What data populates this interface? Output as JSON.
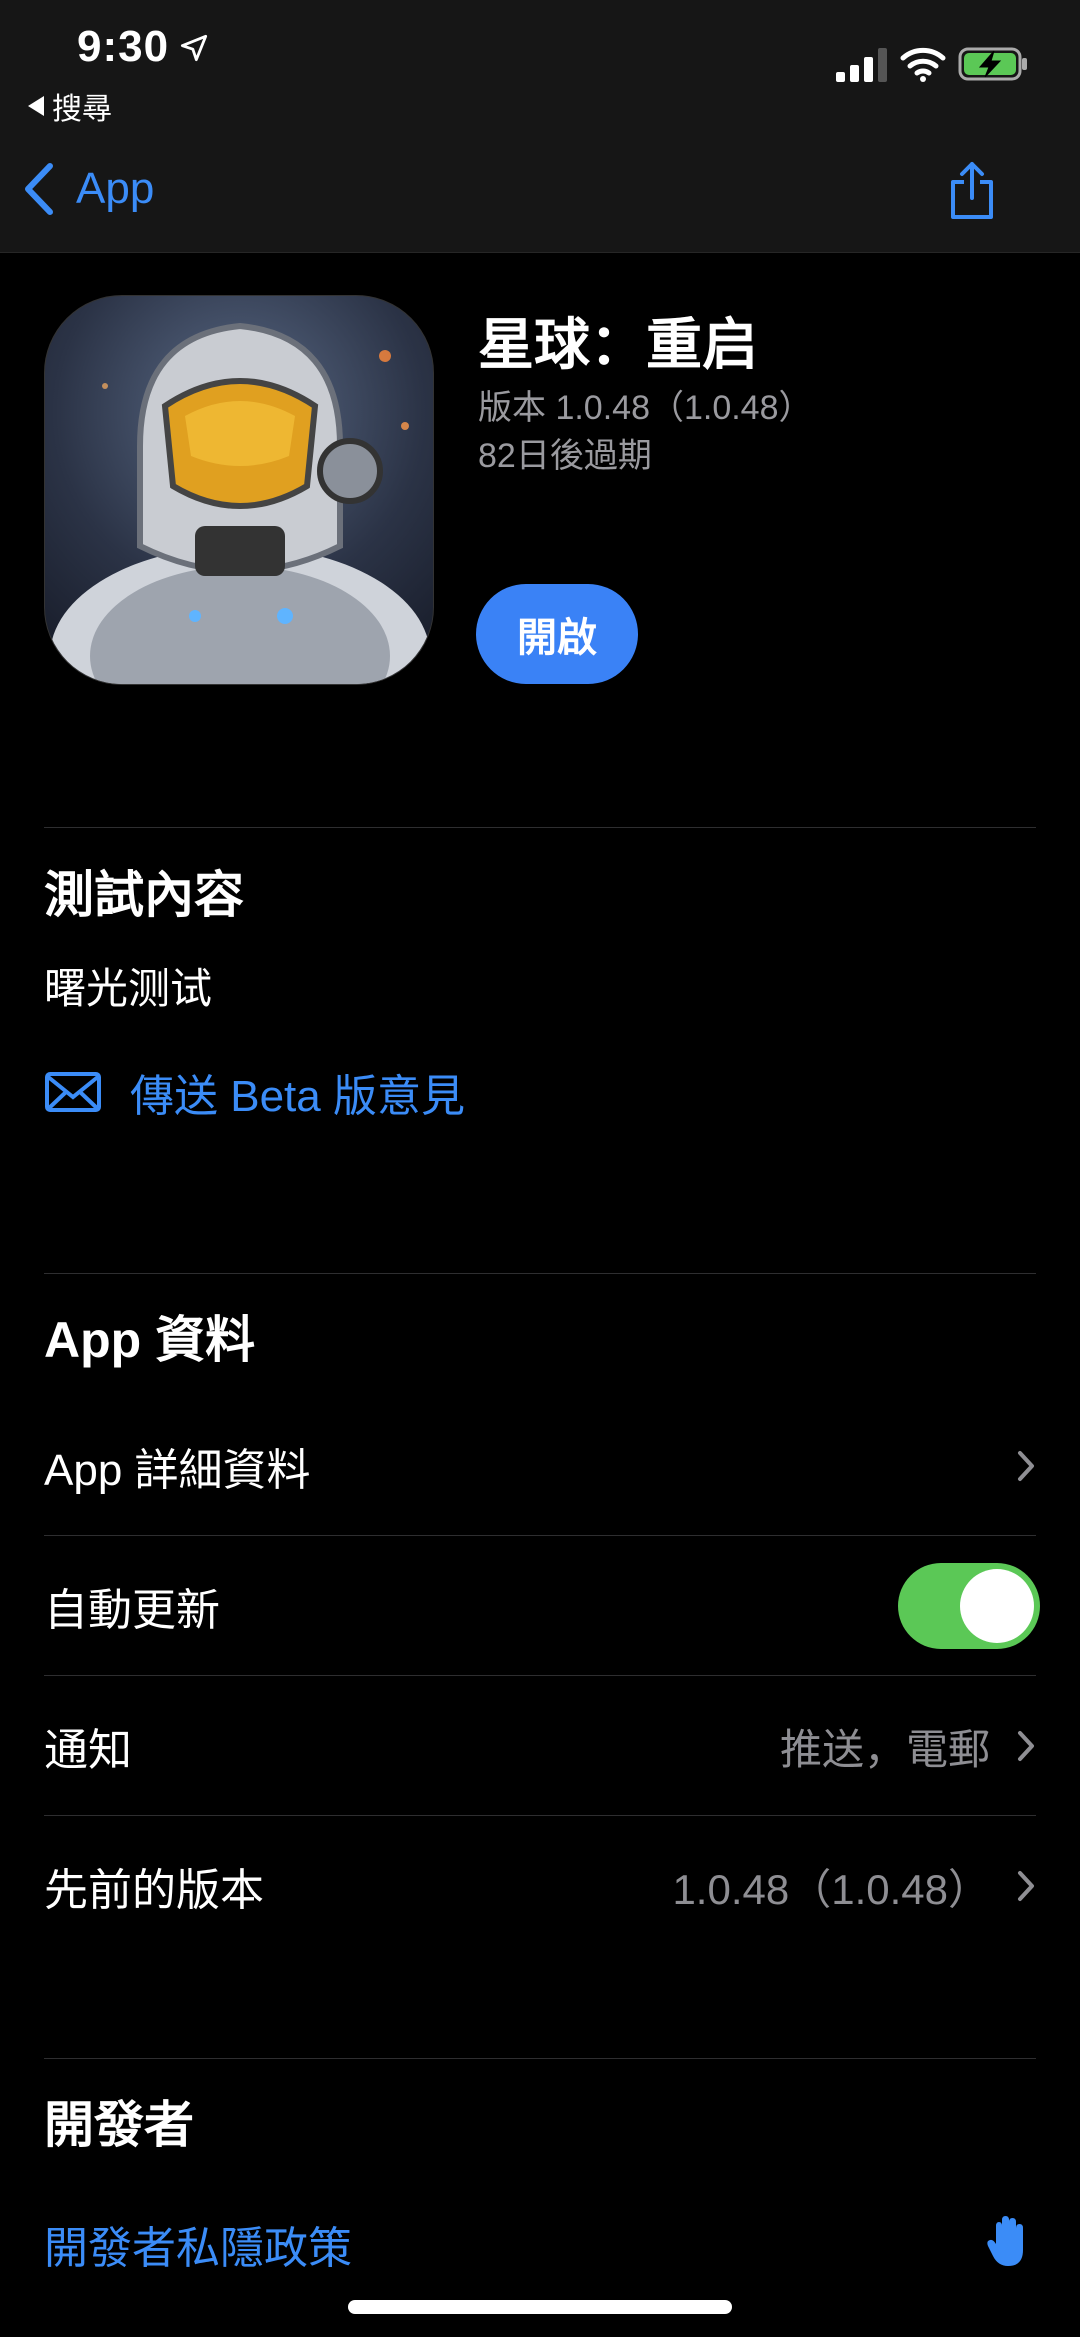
{
  "status_bar": {
    "time": "9:30",
    "back_label": "搜尋"
  },
  "nav": {
    "back_label": "App"
  },
  "app": {
    "title": "星球：重启",
    "version": "版本 1.0.48（1.0.48）",
    "expiry": "82日後過期",
    "open_label": "開啟"
  },
  "test_section": {
    "title": "測試內容",
    "content": "曙光测试",
    "feedback_label": "傳送 Beta 版意見"
  },
  "app_info": {
    "title": "App 資料",
    "rows": [
      {
        "label": "App 詳細資料",
        "value": ""
      },
      {
        "label": "自動更新",
        "value": ""
      },
      {
        "label": "通知",
        "value": "推送，電郵"
      },
      {
        "label": "先前的版本",
        "value": "1.0.48（1.0.48）"
      }
    ],
    "auto_update_on": true
  },
  "developer": {
    "title": "開發者",
    "privacy_label": "開發者私隱政策"
  },
  "colors": {
    "accent": "#3b8cf7",
    "toggle_on": "#5bc856",
    "secondary_text": "#8e8e93"
  }
}
